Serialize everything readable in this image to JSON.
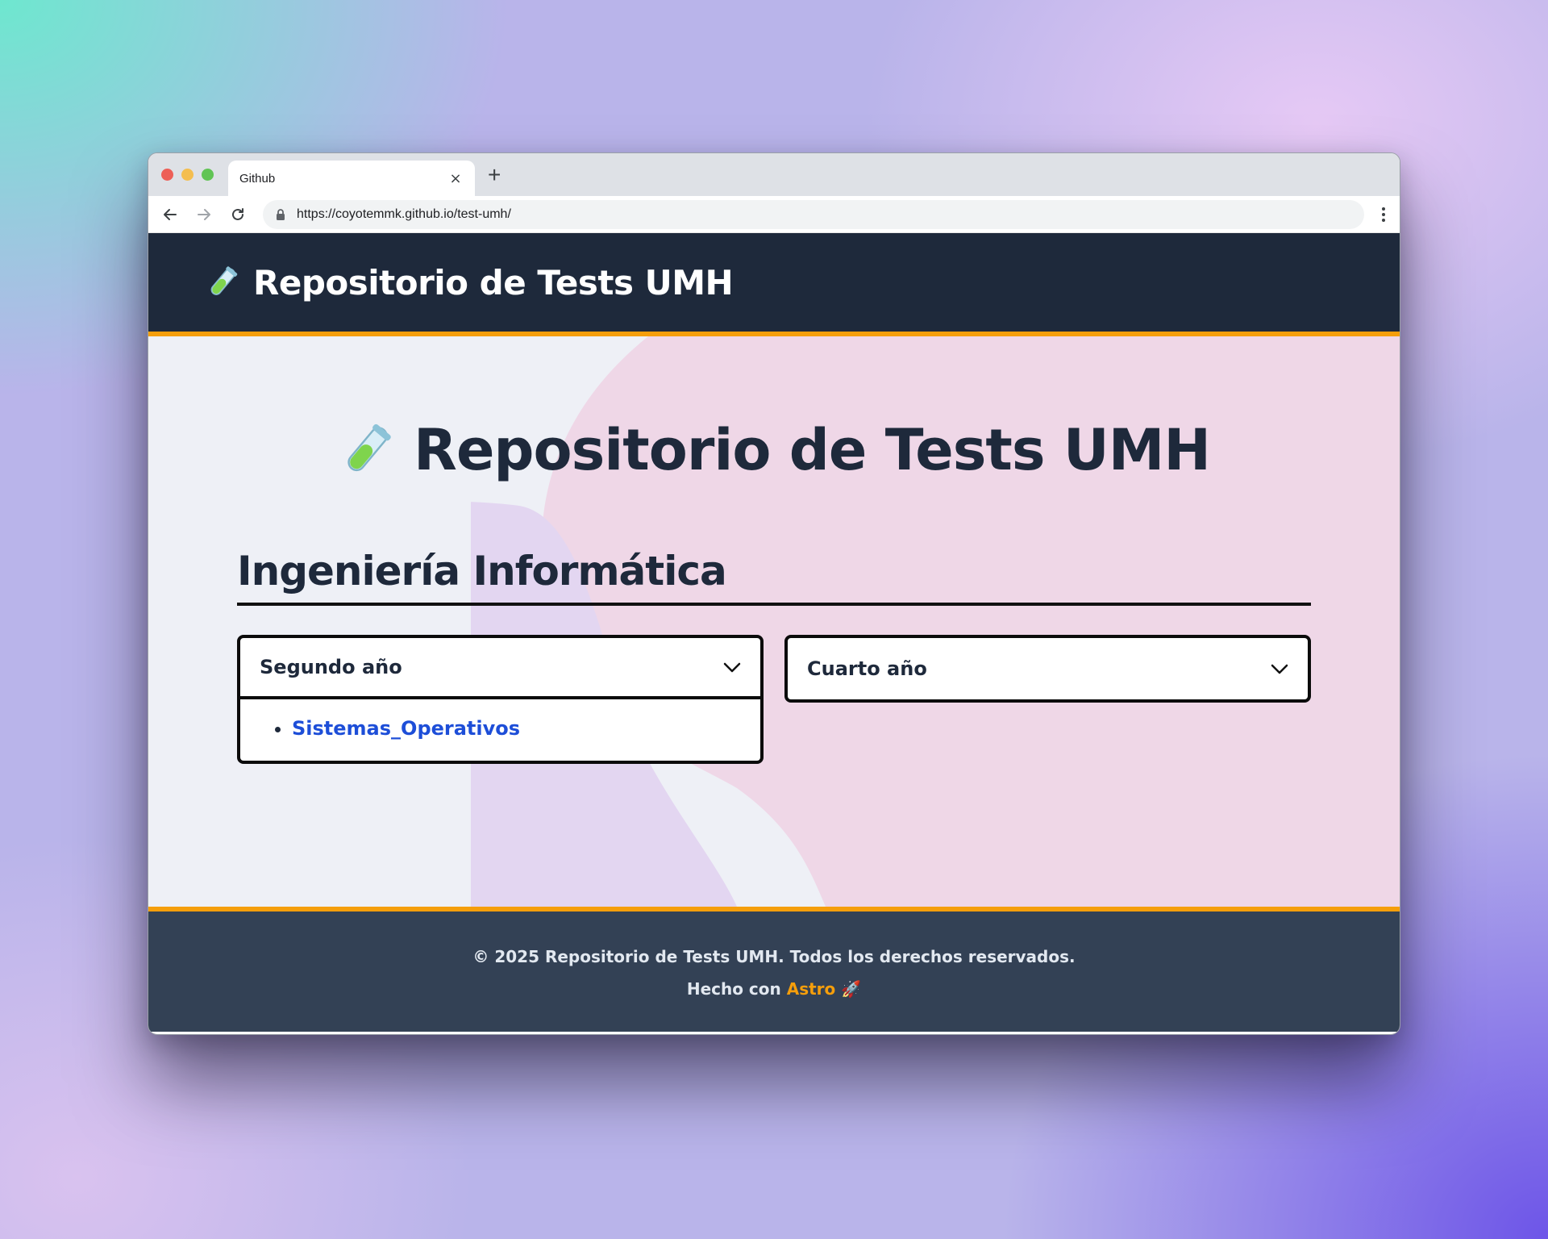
{
  "browser": {
    "tab_title": "Github",
    "tab_close": "×",
    "new_tab": "+",
    "url": "https://coyotemmk.github.io/test-umh/",
    "back_icon": "arrow-left-icon",
    "forward_icon": "arrow-right-icon",
    "reload_icon": "reload-icon",
    "lock_icon": "lock-icon",
    "menu_icon": "kebab-menu-icon"
  },
  "header": {
    "brand_icon": "test-tube-icon",
    "brand": "Repositorio de Tests UMH"
  },
  "main": {
    "title_icon": "test-tube-icon",
    "title": "Repositorio de Tests UMH",
    "section": "Ingeniería Informática",
    "cards": [
      {
        "title": "Segundo año",
        "expanded": true,
        "items": [
          "Sistemas_Operativos"
        ]
      },
      {
        "title": "Cuarto año",
        "expanded": false,
        "items": []
      }
    ]
  },
  "footer": {
    "copyright": "© 2025 Repositorio de Tests UMH. Todos los derechos reservados.",
    "made_with": "Hecho con",
    "made_with_link": "Astro",
    "made_with_emoji": "🚀"
  },
  "colors": {
    "header_bg": "#1e293b",
    "accent": "#f59e0b",
    "footer_bg": "#334155",
    "link": "#1d4ed8"
  }
}
